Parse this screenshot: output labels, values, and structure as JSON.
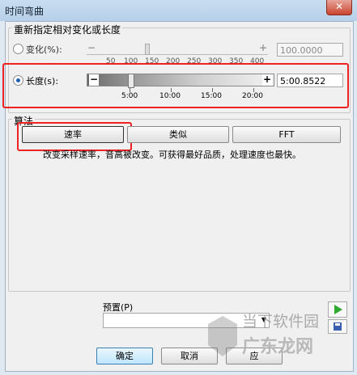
{
  "window": {
    "title": "时间弯曲",
    "close_glyph": "✕"
  },
  "group": {
    "title": "重新指定相对变化或长度"
  },
  "change": {
    "label": "变化(%):",
    "value": "100.0000",
    "minus": "−",
    "plus": "+",
    "ticks": [
      "50",
      "100",
      "150",
      "200",
      "250",
      "300",
      "350",
      "400"
    ]
  },
  "length": {
    "label": "长度(s):",
    "value": "5:00.8522",
    "minus": "−",
    "plus": "+",
    "ticks": [
      "5:00",
      "10:00",
      "15:00",
      "20:00"
    ]
  },
  "algorithm": {
    "title": "算法",
    "buttons": [
      "速率",
      "类似",
      "FFT"
    ],
    "description": "改变采样速率，音高被改变。可获得最好品质，处理速度也最快。"
  },
  "preset": {
    "label": "预置(P)",
    "value": ""
  },
  "footer": {
    "ok": "确定",
    "cancel": "取消",
    "apply": "应"
  },
  "watermark": {
    "line1": "当下软件园",
    "line2": "广东龙网"
  },
  "colors": {
    "highlight": "#e22222",
    "play": "#2fa82f"
  }
}
